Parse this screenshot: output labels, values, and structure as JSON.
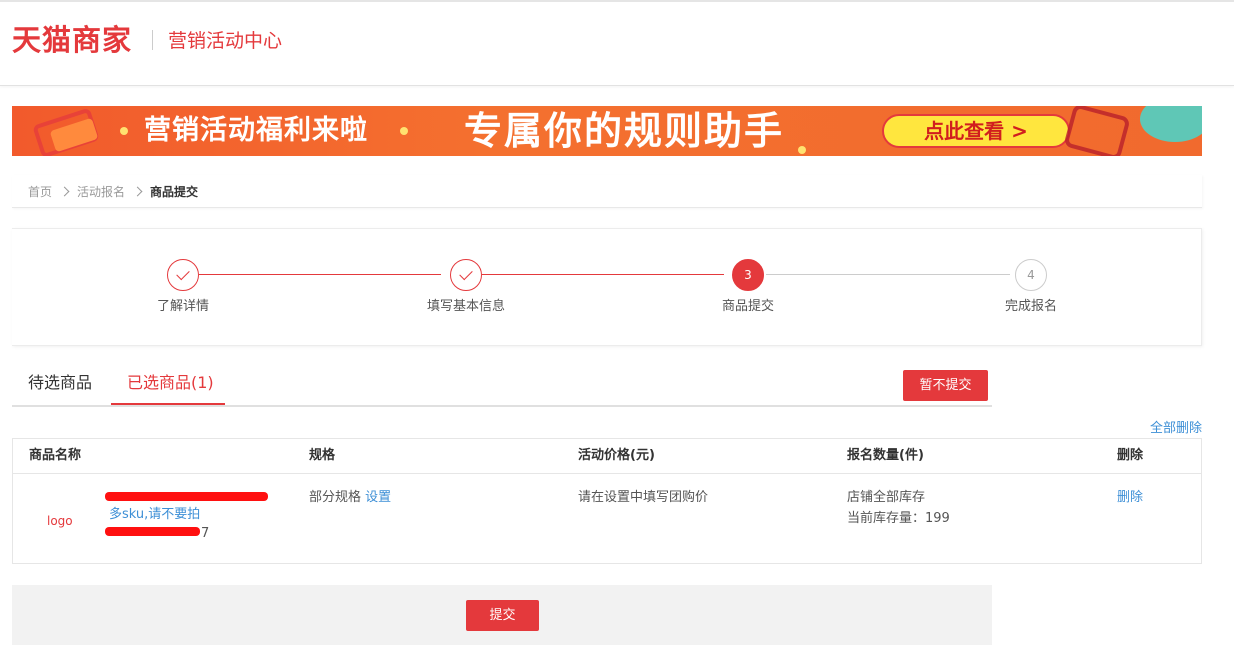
{
  "header": {
    "logo_text": "天猫商家",
    "title": "营销活动中心"
  },
  "banner": {
    "text_left": "营销活动福利来啦",
    "text_main": "专属你的规则助手",
    "cta_label": "点此查看 >"
  },
  "breadcrumb": {
    "items": [
      "首页",
      "活动报名",
      "商品提交"
    ]
  },
  "steps": {
    "items": [
      {
        "number": "1",
        "label": "了解详情",
        "status": "done"
      },
      {
        "number": "2",
        "label": "填写基本信息",
        "status": "done"
      },
      {
        "number": "3",
        "label": "商品提交",
        "status": "active"
      },
      {
        "number": "4",
        "label": "完成报名",
        "status": "todo"
      }
    ]
  },
  "tabs": {
    "items": [
      {
        "label": "待选商品",
        "active": false
      },
      {
        "label": "已选商品(1)",
        "active": true
      }
    ],
    "hold_button_label": "暂不提交"
  },
  "table": {
    "delete_all_label": "全部删除",
    "columns": [
      "商品名称",
      "规格",
      "活动价格(元)",
      "报名数量(件)",
      "删除"
    ],
    "rows": [
      {
        "image_text": "logo",
        "name_line2": "多sku,请不要拍",
        "name_line3_suffix": "7",
        "spec_text": "部分规格",
        "spec_link": "设置",
        "price_text": "请在设置中填写团购价",
        "quantity_line1": "店铺全部库存",
        "quantity_line2": "当前库存量：199",
        "delete_label": "删除"
      }
    ]
  },
  "footer": {
    "submit_label": "提交"
  },
  "colors": {
    "brand_red": "#e4393c",
    "link_blue": "#3d8fd6",
    "banner_orange": "#f25a2c"
  }
}
